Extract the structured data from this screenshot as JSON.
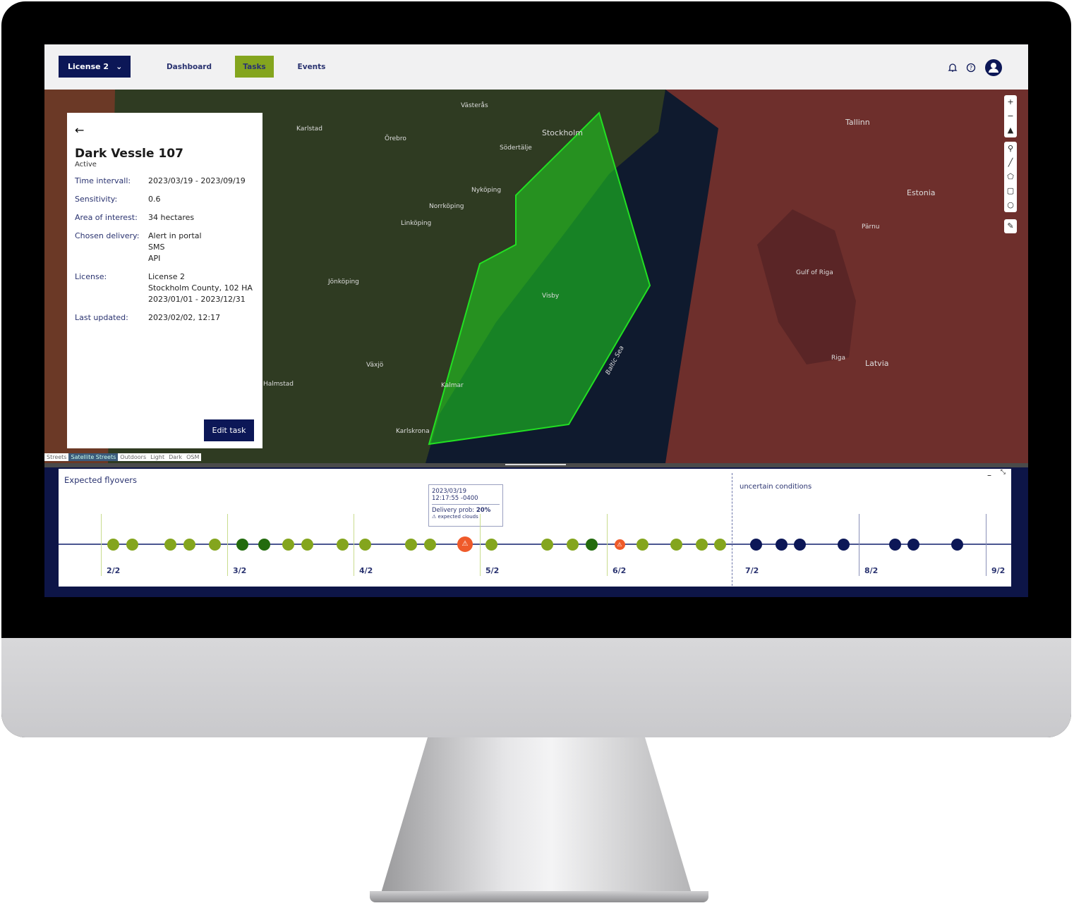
{
  "header": {
    "license": "License 2",
    "nav": [
      "Dashboard",
      "Tasks",
      "Events"
    ],
    "active_nav": "Tasks",
    "accent": "#84a51e",
    "navy": "#0c1757"
  },
  "panel": {
    "title": "Dark Vessle 107",
    "status": "Active",
    "rows": [
      {
        "k": "Time intervall:",
        "v": [
          "2023/03/19 - 2023/09/19"
        ]
      },
      {
        "k": "Sensitivity:",
        "v": [
          "0.6"
        ]
      },
      {
        "k": "Area of interest:",
        "v": [
          "34 hectares"
        ]
      },
      {
        "k": "Chosen delivery:",
        "v": [
          "Alert in portal",
          "SMS",
          "API"
        ]
      },
      {
        "k": "License:",
        "v": [
          "License 2",
          "Stockholm County, 102 HA",
          "2023/01/01 - 2023/12/31"
        ]
      },
      {
        "k": "Last updated:",
        "v": [
          "2023/02/02, 12:17"
        ]
      }
    ],
    "edit_button": "Edit task"
  },
  "map": {
    "styles": [
      "Streets",
      "Satellite Streets",
      "Outdoors",
      "Light",
      "Dark",
      "OSM"
    ],
    "active_style": "Satellite Streets",
    "labels": [
      "Stockholm",
      "Västerås",
      "Norrköping",
      "Linköping",
      "Jönköping",
      "Kalmar",
      "Karlskrona",
      "Visby",
      "Baltic Sea",
      "Tallinn",
      "Estonia",
      "Gulf of Riga",
      "Riga",
      "Latvia",
      "Pärnu",
      "Södertälje",
      "Nyköping",
      "Örebro",
      "Karlstad",
      "Halmstad",
      "Växjö"
    ]
  },
  "timeline": {
    "title": "Expected flyovers",
    "uncertain_label": "uncertain conditions",
    "ticks": [
      "2/2",
      "3/2",
      "4/2",
      "5/2",
      "6/2",
      "7/2",
      "8/2",
      "9/2"
    ],
    "tooltip": {
      "date": "2023/03/19",
      "time": "12:17:55 -0400",
      "prob_label": "Delivery prob:",
      "prob": "20%",
      "warning": "expected clouds"
    },
    "colors": {
      "good": "#84a51e",
      "best": "#236b0e",
      "warning": "#ef5a2a",
      "uncertain": "#0c1757"
    },
    "flyovers": [
      "good",
      "good",
      "good",
      "good",
      "good",
      "best",
      "best",
      "good",
      "good",
      "good",
      "good",
      "good",
      "good",
      "warning",
      "good",
      "good",
      "good",
      "best",
      "warning",
      "good",
      "good",
      "good",
      "good",
      "uncertain",
      "uncertain",
      "uncertain",
      "uncertain",
      "uncertain",
      "uncertain",
      "uncertain"
    ]
  }
}
